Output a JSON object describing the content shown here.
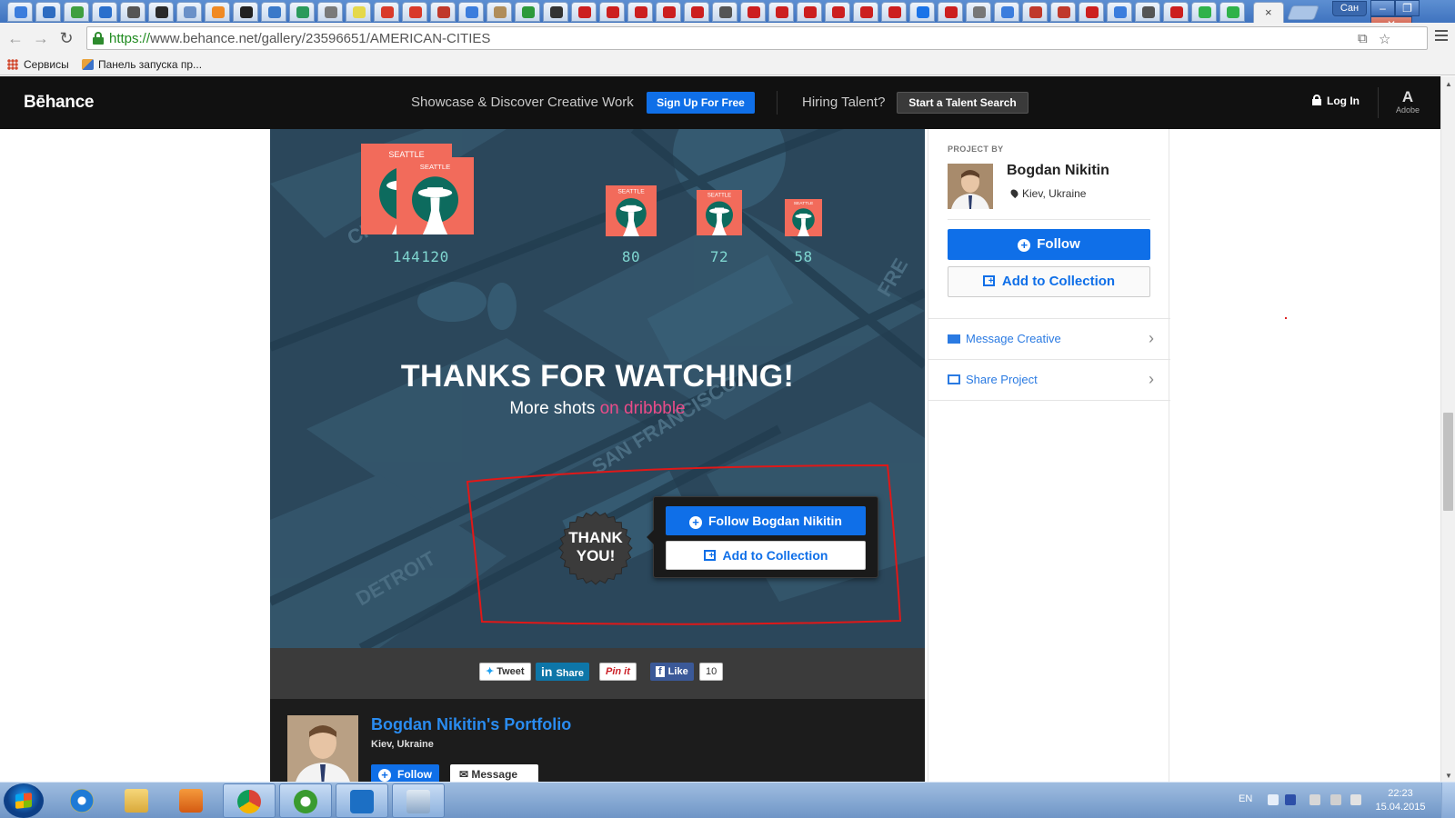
{
  "browser": {
    "user_chip": "Сан",
    "close_tab_glyph": "×",
    "url_scheme": "https://",
    "url_host": "www.behance.net",
    "url_path": "/gallery/23596651/AMERICAN-CITIES",
    "bookmarks": [
      "Сервисы",
      "Панель запуска пр..."
    ],
    "tab_icon_colors": [
      "#3b7ddd",
      "#2d6cc1",
      "#3f9f3f",
      "#2a6fcc",
      "#555555",
      "#2a2a2a",
      "#6a90c8",
      "#f08a24",
      "#222222",
      "#3a79c9",
      "#2a9a5c",
      "#7a7a7a",
      "#e5d84a",
      "#d93a2a",
      "#d93a2a",
      "#c0392b",
      "#3b7ddd",
      "#b08d5a",
      "#2d9a3a",
      "#333333",
      "#cc1f1f",
      "#cc1f1f",
      "#cc1f1f",
      "#cc1f1f",
      "#cc1f1f",
      "#555555",
      "#cc1f1f",
      "#cc1f1f",
      "#cc1f1f",
      "#cc1f1f",
      "#cc1f1f",
      "#cc1f1f",
      "#1a73e8",
      "#cc1f1f",
      "#777777",
      "#3b7ddd",
      "#c0392b",
      "#c0392b",
      "#cc1f1f",
      "#3b7ddd",
      "#555555",
      "#cc1f1f",
      "#2fb24a",
      "#2fb24a"
    ]
  },
  "behance": {
    "logo": "Bēhance",
    "tagline": "Showcase & Discover Creative Work",
    "signup": "Sign Up For Free",
    "hiring": "Hiring Talent?",
    "talent_search": "Start a Talent Search",
    "login": "Log In",
    "adobe_mark": "A",
    "adobe": "Adobe"
  },
  "project": {
    "icon_label": "SEATTLE",
    "icon_sizes": [
      "144",
      "120",
      "80",
      "72",
      "58"
    ],
    "thanks_heading": "THANKS FOR WATCHING!",
    "more_shots_prefix": "More shots ",
    "more_shots_link": "on dribbble",
    "badge_text_line1": "THANK",
    "badge_text_line2": "YOU!",
    "popup_follow": "Follow Bogdan Nikitin",
    "popup_collection": "Add to Collection",
    "map_labels": [
      "CHICAGO",
      "SAN FRANCISCO",
      "DETROIT",
      "FRE"
    ]
  },
  "share": {
    "tweet": "Tweet",
    "linkedin": "Share",
    "pinterest": "Pin it",
    "facebook": "Like",
    "facebook_count": "10"
  },
  "owner": {
    "portfolio_title": "Bogdan Nikitin's Portfolio",
    "location": "Kiev, Ukraine",
    "follow": "Follow",
    "message": "Message"
  },
  "sidebar": {
    "project_by": "PROJECT BY",
    "name": "Bogdan Nikitin",
    "location": "Kiev, Ukraine",
    "follow": "Follow",
    "add_collection": "Add to Collection",
    "message_creative": "Message Creative",
    "share_project": "Share Project"
  },
  "taskbar": {
    "language": "EN",
    "time": "22:23",
    "date": "15.04.2015"
  },
  "colors": {
    "behance_blue": "#0f6fe8",
    "dribbble_pink": "#ea4c89",
    "icon_coral": "#f26b5b",
    "icon_teal": "#0d6b5e",
    "annotation_red": "#e01818"
  }
}
